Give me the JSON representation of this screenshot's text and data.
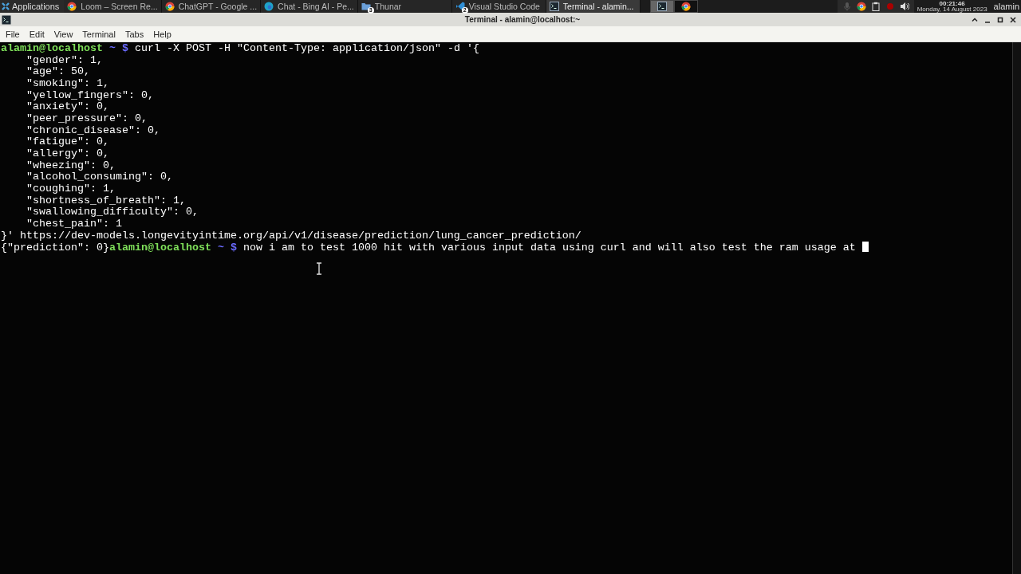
{
  "taskbar": {
    "apps_menu": "Applications",
    "tasks": [
      {
        "label": "Loom – Screen Re...",
        "kind": "chrome",
        "selected": false
      },
      {
        "label": "ChatGPT - Google ...",
        "kind": "chrome",
        "selected": false
      },
      {
        "label": "Chat - Bing AI - Pe...",
        "kind": "edge",
        "selected": false
      },
      {
        "label": "Thunar",
        "kind": "folder",
        "badge": "3",
        "selected": false
      },
      {
        "label": "Visual Studio Code",
        "kind": "vscode",
        "badge": "2",
        "selected": false
      },
      {
        "label": "Terminal - alamin...",
        "kind": "terminal",
        "selected": true
      }
    ],
    "workspaces": [
      {
        "kind": "terminal",
        "selected": true
      },
      {
        "kind": "chrome",
        "selected": false
      }
    ],
    "tray": [
      {
        "kind": "mic"
      },
      {
        "kind": "chrome"
      },
      {
        "kind": "clipboard"
      },
      {
        "kind": "record"
      },
      {
        "kind": "volume"
      }
    ],
    "time": "00:21:46",
    "date": "Monday, 14 August 2023",
    "user": "alamin"
  },
  "window": {
    "title": "Terminal - alamin@localhost:~"
  },
  "menu": [
    "File",
    "Edit",
    "View",
    "Terminal",
    "Tabs",
    "Help"
  ],
  "terminal": {
    "lines": [
      [
        {
          "kind": "user",
          "text": "alamin@localhost"
        },
        {
          "kind": "dir",
          "text": "~ $"
        },
        {
          "kind": "out",
          "text": "curl -X POST -H \"Content-Type: application/json\" -d '{"
        }
      ],
      [
        {
          "kind": "out",
          "text": "    \"gender\": 1,"
        }
      ],
      [
        {
          "kind": "out",
          "text": "    \"age\": 50,"
        }
      ],
      [
        {
          "kind": "out",
          "text": "    \"smoking\": 1,"
        }
      ],
      [
        {
          "kind": "out",
          "text": "    \"yellow_fingers\": 0,"
        }
      ],
      [
        {
          "kind": "out",
          "text": "    \"anxiety\": 0,"
        }
      ],
      [
        {
          "kind": "out",
          "text": "    \"peer_pressure\": 0,"
        }
      ],
      [
        {
          "kind": "out",
          "text": "    \"chronic_disease\": 0,"
        }
      ],
      [
        {
          "kind": "out",
          "text": "    \"fatigue\": 0,"
        }
      ],
      [
        {
          "kind": "out",
          "text": "    \"allergy\": 0,"
        }
      ],
      [
        {
          "kind": "out",
          "text": "    \"wheezing\": 0,"
        }
      ],
      [
        {
          "kind": "out",
          "text": "    \"alcohol_consuming\": 0,"
        }
      ],
      [
        {
          "kind": "out",
          "text": "    \"coughing\": 1,"
        }
      ],
      [
        {
          "kind": "out",
          "text": "    \"shortness_of_breath\": 1,"
        }
      ],
      [
        {
          "kind": "out",
          "text": "    \"swallowing_difficulty\": 0,"
        }
      ],
      [
        {
          "kind": "out",
          "text": "    \"chest_pain\": 1"
        }
      ],
      [
        {
          "kind": "out",
          "text": "}' https://dev-models.longevityintime.org/api/v1/disease/prediction/lung_cancer_prediction/"
        }
      ],
      [
        {
          "kind": "out",
          "text": "{\"prediction\": 0}"
        },
        {
          "kind": "user",
          "text": "alamin@localhost"
        },
        {
          "kind": "dir",
          "text": "~ $"
        },
        {
          "kind": "out",
          "text": "now i am to test 1000 hit with various input data using curl and will also test the ram usage at"
        },
        {
          "kind": "cursor"
        }
      ]
    ]
  }
}
